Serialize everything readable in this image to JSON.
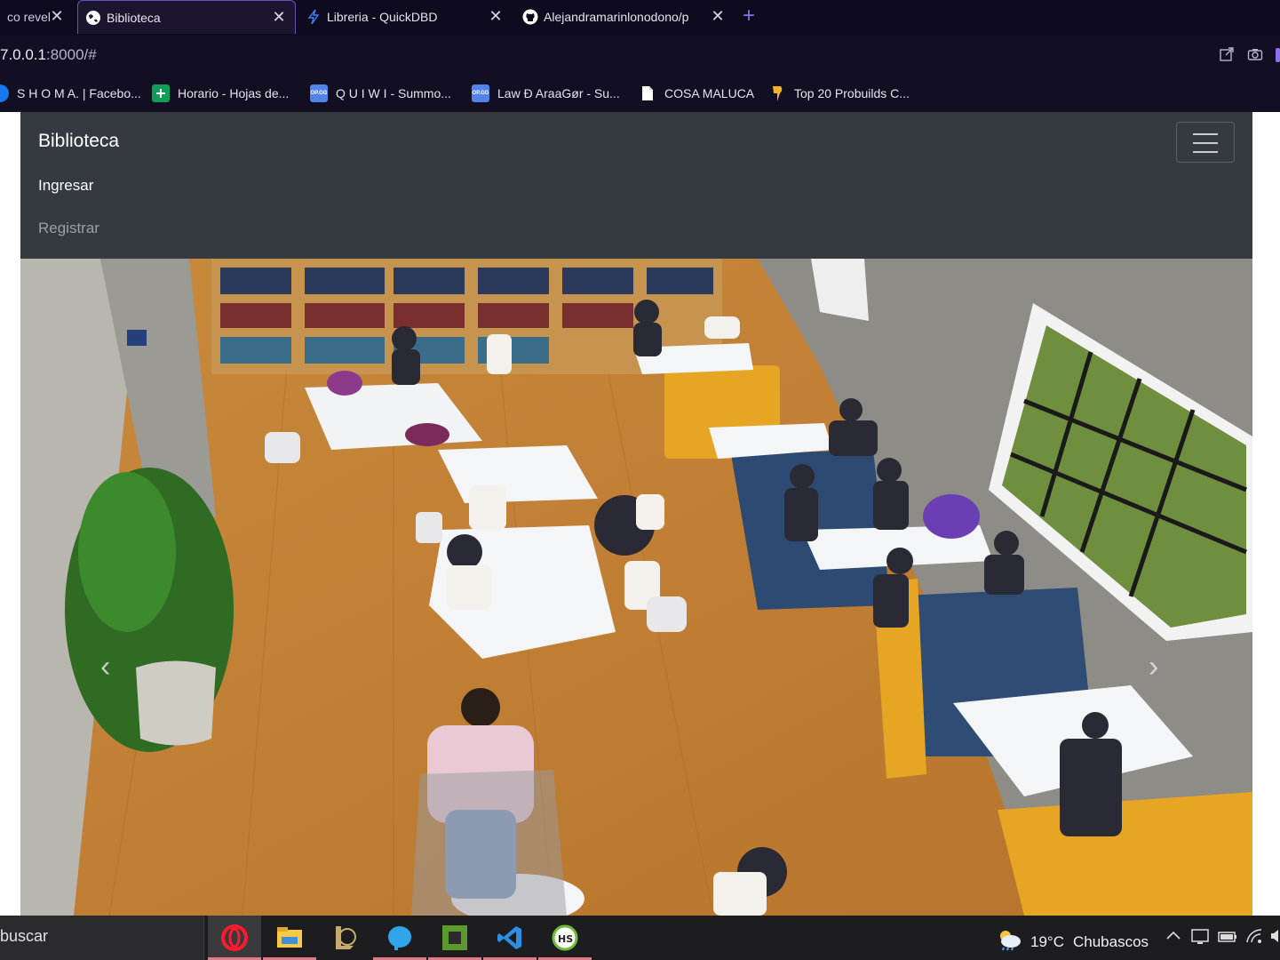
{
  "browser": {
    "tabs": [
      {
        "title": "co revel",
        "active": false
      },
      {
        "title": "Biblioteca",
        "active": true
      },
      {
        "title": "Libreria - QuickDBD",
        "active": false
      },
      {
        "title": "Alejandramarinlonodono/p",
        "active": false
      }
    ],
    "new_tab_symbol": "+",
    "close_symbol": "✕",
    "address": {
      "host": "7.0.0.1",
      "rest": ":8000/#"
    },
    "bookmarks": [
      {
        "label": "S H O M A. | Facebo...",
        "icon": "facebook-icon"
      },
      {
        "label": "Horario - Hojas de...",
        "icon": "sheets-icon"
      },
      {
        "label": "Q U I W I - Summo...",
        "icon": "opgg-icon"
      },
      {
        "label": "Law Ð AraaGør - Su...",
        "icon": "opgg-icon"
      },
      {
        "label": "COSA MALUCA",
        "icon": "document-icon"
      },
      {
        "label": "Top 20 Probuilds C...",
        "icon": "probuilds-icon"
      }
    ]
  },
  "navbar": {
    "brand": "Biblioteca",
    "links": [
      "Ingresar",
      "Registrar"
    ]
  },
  "carousel": {
    "prev_symbol": "‹",
    "next_symbol": "›"
  },
  "taskbar": {
    "search_text": "buscar",
    "apps": [
      "opera-icon",
      "file-explorer-icon",
      "league-client-icon",
      "elephant-icon",
      "minecraft-icon",
      "vscode-icon",
      "hs-icon"
    ],
    "weather_temp": "19°C",
    "weather_text": "Chubascos"
  },
  "colors": {
    "navbar_bg": "#343a40",
    "browser_bg": "#120f22",
    "accent": "#8f6fe8"
  }
}
